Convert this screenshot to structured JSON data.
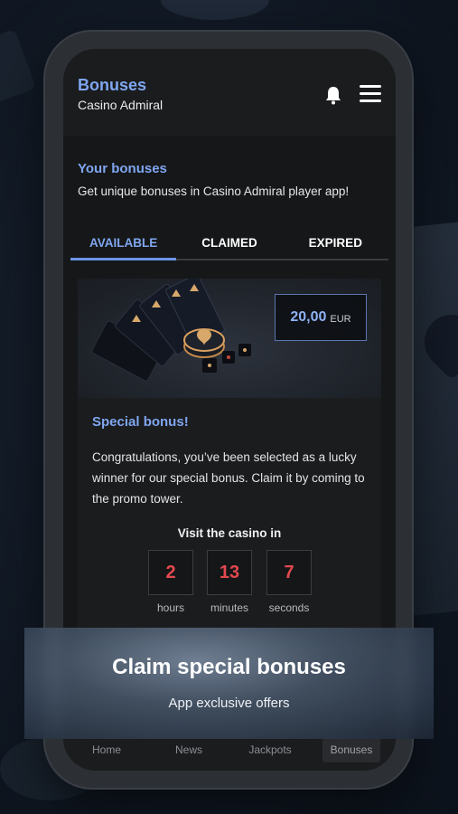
{
  "header": {
    "title": "Bonuses",
    "subtitle": "Casino Admiral",
    "bell_icon": "bell-icon",
    "menu_icon": "hamburger-menu-icon"
  },
  "intro": {
    "title": "Your bonuses",
    "description": "Get unique bonuses in Casino Admiral player app!"
  },
  "tabs": [
    {
      "label": "AVAILABLE",
      "active": true
    },
    {
      "label": "CLAIMED",
      "active": false
    },
    {
      "label": "EXPIRED",
      "active": false
    }
  ],
  "bonus_card": {
    "amount": "20,00",
    "currency": "EUR",
    "title": "Special bonus!",
    "text": "Congratulations, you’ve been selected as a lucky winner for our special bonus. Claim it by coming to the promo tower.",
    "countdown_title": "Visit the casino in",
    "countdown": [
      {
        "value": "2",
        "label": "hours"
      },
      {
        "value": "13",
        "label": "minutes"
      },
      {
        "value": "7",
        "label": "seconds"
      }
    ]
  },
  "bottom_nav": [
    {
      "label": "Home",
      "active": false
    },
    {
      "label": "News",
      "active": false
    },
    {
      "label": "Jackpots",
      "active": false
    },
    {
      "label": "Bonuses",
      "active": true
    }
  ],
  "promo": {
    "title": "Claim special bonuses",
    "subtitle": "App exclusive offers"
  },
  "colors": {
    "accent": "#7fa6f0",
    "countdown": "#e2494f",
    "background": "#161718"
  }
}
